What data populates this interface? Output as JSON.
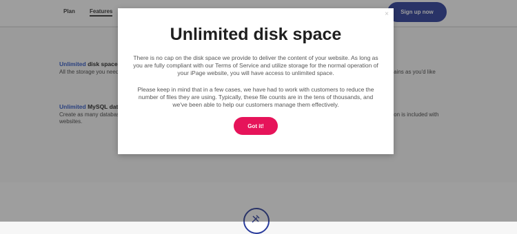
{
  "nav": {
    "plan_label": "Plan",
    "features_label": "Features",
    "signup_label": "Sign up now"
  },
  "features": {
    "disk": {
      "accent": "Unlimited",
      "title": " disk space",
      "desc": "All the storage you need for your website."
    },
    "mysql": {
      "accent": "Unlimited",
      "title": " MySQL databases",
      "desc": "Create as many databases as you need for your hosted websites."
    },
    "right_top": {
      "title": "es",
      "desc": "omains as you'd like"
    },
    "right_bottom": {
      "desc": "ration is included with"
    }
  },
  "modal": {
    "close_icon": "×",
    "title": "Unlimited disk space",
    "paragraph1": "There is no cap on the disk space we provide to deliver the content of your website. As long as you are fully compliant with our Terms of Service and utilize storage for the normal operation of your iPage website, you will have access to unlimited space.",
    "paragraph2": "Please keep in mind that in a few cases, we have had to work with customers to reduce the number of files they are using. Typically, these file counts are in the tens of thousands, and we've been able to help our customers manage them effectively.",
    "button_label": "Got it!"
  },
  "colors": {
    "accent_blue": "#2a55c7",
    "brand_navy": "#2a3c9c",
    "button_pink": "#e6145a"
  }
}
